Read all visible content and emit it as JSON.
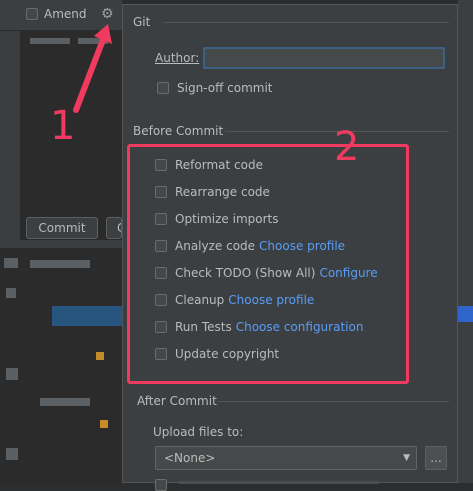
{
  "left_panel": {
    "amend_label": "Amend",
    "commit_button": "Commit",
    "second_button_partial": "C"
  },
  "popup": {
    "git_section": "Git",
    "author_label": "Author:",
    "author_value": "",
    "signoff_label": "Sign-off commit",
    "before_commit_section": "Before Commit",
    "options": [
      {
        "label": "Reformat code",
        "link": ""
      },
      {
        "label": "Rearrange code",
        "link": ""
      },
      {
        "label": "Optimize imports",
        "link": ""
      },
      {
        "label": "Analyze code",
        "link": "Choose profile"
      },
      {
        "label": "Check TODO (Show All)",
        "link": "Configure"
      },
      {
        "label": "Cleanup",
        "link": "Choose profile"
      },
      {
        "label": "Run Tests",
        "link": "Choose configuration"
      },
      {
        "label": "Update copyright",
        "link": ""
      }
    ],
    "after_commit_section": "After Commit",
    "upload_label": "Upload files to:",
    "upload_value": "<None>",
    "more_button": "..."
  },
  "annotations": {
    "arrow_number": "1",
    "box_number": "2"
  },
  "colors": {
    "annotation": "#f03a5f",
    "link": "#589df6"
  }
}
